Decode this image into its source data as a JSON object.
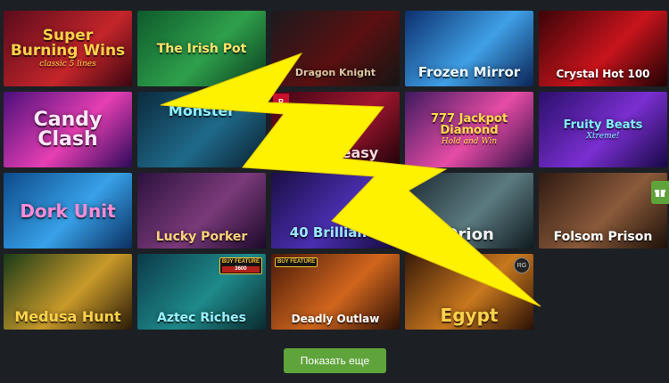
{
  "games": [
    {
      "title": "Super Burning Wins",
      "subtitle": "classic 5 lines",
      "bg": "linear-gradient(135deg,#5a0b1c,#c4262a 60%,#3b0611)",
      "color": "#ffd24a",
      "size": 17
    },
    {
      "title": "The Irish Pot",
      "subtitle": "",
      "bg": "linear-gradient(135deg,#0e5a2c,#2fa04b 55%,#0a3b1d)",
      "color": "#ffe36b",
      "size": 14
    },
    {
      "title": "Dragon Knight",
      "subtitle": "",
      "bg": "linear-gradient(135deg,#1a1a1e,#5a1010 55%,#151515)",
      "color": "#d8c6a0",
      "size": 11
    },
    {
      "title": "Frozen Mirror",
      "subtitle": "",
      "bg": "linear-gradient(135deg,#0d2f6e,#3fa0e6 55%,#0b2355)",
      "color": "#eaf6ff",
      "size": 15
    },
    {
      "title": "Crystal Hot 100",
      "subtitle": "",
      "bg": "linear-gradient(135deg,#3b0408,#c8141c 55%,#1e0204)",
      "color": "#ffffff",
      "size": 12
    },
    {
      "title": "Candy Clash",
      "subtitle": "",
      "bg": "linear-gradient(135deg,#4a0f7a,#e63fb3 55%,#2b0a5a)",
      "color": "#ffe6fb",
      "size": 22
    },
    {
      "title": "Monster",
      "subtitle": "",
      "bg": "linear-gradient(135deg,#0b2a3d,#1f6a8a 55%,#0a1f2e)",
      "color": "#8ef0ff",
      "size": 16
    },
    {
      "title": "Speakeasy",
      "subtitle": "",
      "bg": "linear-gradient(135deg,#3a0512,#a11630 55%,#1e0208)",
      "color": "#ffd8e0",
      "size": 16
    },
    {
      "title": "777 Jackpot Diamond",
      "subtitle": "Hold and Win",
      "bg": "linear-gradient(135deg,#3c1a5e,#e74ca6 55%,#2a0f45)",
      "color": "#ffd94a",
      "size": 13
    },
    {
      "title": "Fruity Beats",
      "subtitle": "Xtreme!",
      "bg": "linear-gradient(135deg,#2a0f6a,#7a2fd0 55%,#170845)",
      "color": "#7ef0ff",
      "size": 13
    },
    {
      "title": "Dork Unit",
      "subtitle": "",
      "bg": "linear-gradient(135deg,#0c4a8a,#38a1e8 55%,#0a2f5f)",
      "color": "#ff8ad6",
      "size": 20
    },
    {
      "title": "Lucky Porker",
      "subtitle": "",
      "bg": "linear-gradient(135deg,#2c123e,#7a3a7a 55%,#1c0a2a)",
      "color": "#ffd27a",
      "size": 14
    },
    {
      "title": "40 Brilliants",
      "subtitle": "",
      "bg": "linear-gradient(135deg,#1b0e45,#4b2fb0 55%,#120834)",
      "color": "#9ae6ff",
      "size": 15
    },
    {
      "title": "Orion",
      "subtitle": "",
      "bg": "linear-gradient(135deg,#1a2a30,#5b7a80 55%,#0f1a1e)",
      "color": "#f2f2f2",
      "size": 18
    },
    {
      "title": "Folsom Prison",
      "subtitle": "",
      "bg": "linear-gradient(135deg,#2e1a12,#8a5a3a 55%,#1c100a)",
      "color": "#ffffff",
      "size": 14
    },
    {
      "title": "Medusa Hunt",
      "subtitle": "",
      "bg": "linear-gradient(135deg,#1a3a18,#c89a2a 55%,#2a1a08)",
      "color": "#ffd24a",
      "size": 16
    },
    {
      "title": "Aztec Riches",
      "subtitle": "",
      "bg": "linear-gradient(135deg,#0b3a4a,#1e8a8a 55%,#0a2a2e)",
      "color": "#9af0ff",
      "size": 14
    },
    {
      "title": "Deadly Outlaw",
      "subtitle": "",
      "bg": "linear-gradient(135deg,#4a1a08,#d0661e 55%,#2a0f05)",
      "color": "#ffffff",
      "size": 12
    },
    {
      "title": "Egypt",
      "subtitle": "",
      "bg": "linear-gradient(135deg,#3a1a08,#c8781e 55%,#2a1005)",
      "color": "#ffd24a",
      "size": 20
    }
  ],
  "buy_feature": {
    "label": "BUY FEATURE",
    "price": "3600"
  },
  "buy_feature_2": {
    "label": "BUY FEATURE"
  },
  "provider_square_label": "R",
  "corner_badge_label": "RG",
  "show_more_label": "Показать еще",
  "colors": {
    "page_bg": "#1c1f24",
    "button": "#5fa33b",
    "bolt": "#fff200"
  }
}
